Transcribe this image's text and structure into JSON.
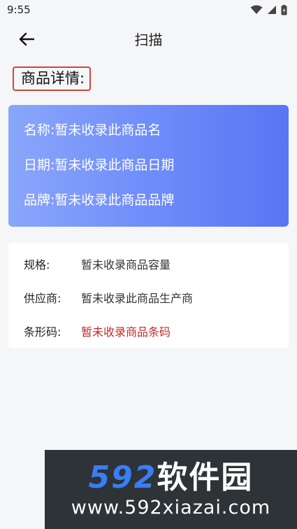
{
  "status_bar": {
    "time": "9:55",
    "icons": [
      "wifi-icon",
      "signal-icon",
      "battery-icon"
    ]
  },
  "header": {
    "title": "扫描",
    "back_icon": "arrow-left-icon"
  },
  "section_label": "商品详情:",
  "product": {
    "name": {
      "label": "名称:",
      "value": "暂未收录此商品名"
    },
    "date": {
      "label": "日期:",
      "value": "暂未收录此商品日期"
    },
    "brand": {
      "label": "品牌:",
      "value": "暂未收录此商品品牌"
    }
  },
  "specs": [
    {
      "label": "规格:",
      "value": "暂未收录商品容量",
      "color": "#333333"
    },
    {
      "label": "供应商:",
      "value": "暂未收录此商品生产商",
      "color": "#333333"
    },
    {
      "label": "条形码:",
      "value": "暂未收录商品条码",
      "color": "#c62828"
    }
  ],
  "watermark": {
    "logo_number": "592",
    "logo_text": "软件园",
    "url": "www.592xiazai.com"
  },
  "colors": {
    "gradient_start": "#8aa6fb",
    "gradient_end": "#5876f3",
    "highlight_border": "#d0453b",
    "barcode_text": "#c62828"
  }
}
